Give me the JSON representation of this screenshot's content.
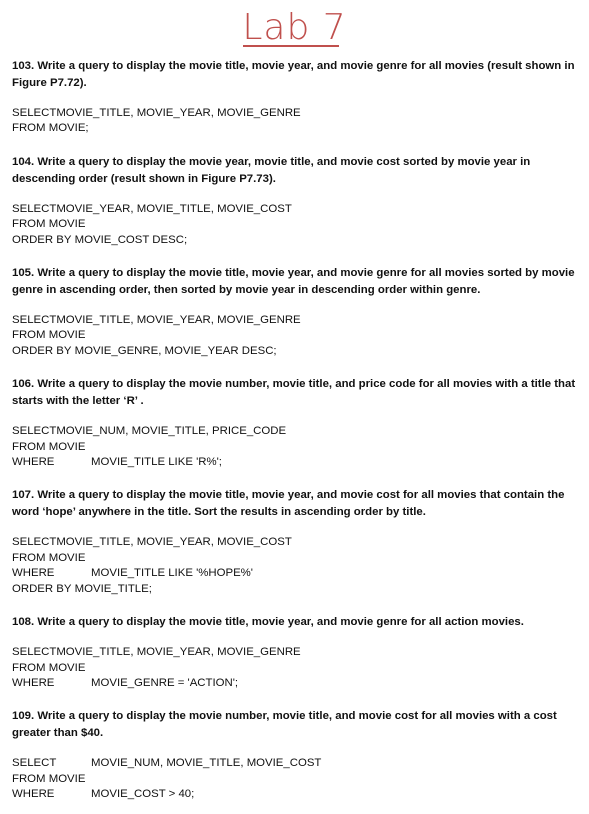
{
  "title": "Lab 7",
  "questions": [
    {
      "text": "103. Write a query to display the movie title, movie year, and movie genre for all movies (result shown in Figure P7.72).",
      "sql": [
        {
          "kw": "SELECT",
          "rest": "MOVIE_TITLE, MOVIE_YEAR, MOVIE_GENRE",
          "wide": false
        },
        {
          "kw": "FROM",
          "rest": " MOVIE;",
          "wide": false
        }
      ]
    },
    {
      "text": "104. Write a query to display the movie year, movie title, and movie cost sorted by movie year in descending order (result shown in Figure P7.73).",
      "sql": [
        {
          "kw": "SELECT",
          "rest": "MOVIE_YEAR, MOVIE_TITLE, MOVIE_COST",
          "wide": false
        },
        {
          "kw": "FROM",
          "rest": " MOVIE",
          "wide": false
        },
        {
          "kw": "ORDER BY",
          "rest": " MOVIE_COST DESC;",
          "wide": false
        }
      ]
    },
    {
      "text": "105. Write a query to display the movie title, movie year, and movie genre for all movies sorted by movie genre in ascending order, then sorted by movie year in descending order within genre.",
      "sql": [
        {
          "kw": "SELECT",
          "rest": "MOVIE_TITLE, MOVIE_YEAR, MOVIE_GENRE",
          "wide": false
        },
        {
          "kw": "FROM",
          "rest": " MOVIE",
          "wide": false
        },
        {
          "kw": "ORDER BY",
          "rest": " MOVIE_GENRE, MOVIE_YEAR DESC;",
          "wide": false
        }
      ]
    },
    {
      "text": "106. Write a query to display the movie number, movie title, and price code for all movies with a title that starts with the letter ‘R’ .",
      "sql": [
        {
          "kw": "SELECT",
          "rest": "MOVIE_NUM, MOVIE_TITLE, PRICE_CODE",
          "wide": false
        },
        {
          "kw": "FROM",
          "rest": " MOVIE",
          "wide": false
        },
        {
          "kw": "WHERE",
          "rest": "MOVIE_TITLE LIKE 'R%';",
          "wide": true
        }
      ]
    },
    {
      "text": "107. Write a query to display the movie title, movie year, and movie cost for all movies that contain the word ‘hope’ anywhere in the title.  Sort the results in ascending order by title.",
      "sql": [
        {
          "kw": "SELECT",
          "rest": "MOVIE_TITLE, MOVIE_YEAR, MOVIE_COST",
          "wide": false
        },
        {
          "kw": "FROM",
          "rest": " MOVIE",
          "wide": false
        },
        {
          "kw": "WHERE",
          "rest": "MOVIE_TITLE LIKE '%HOPE%'",
          "wide": true
        },
        {
          "kw": "ORDER BY",
          "rest": " MOVIE_TITLE;",
          "wide": false
        }
      ]
    },
    {
      "text": "108. Write a query to display the movie title, movie year, and movie genre for all action movies.",
      "sql": [
        {
          "kw": "SELECT",
          "rest": "MOVIE_TITLE, MOVIE_YEAR, MOVIE_GENRE",
          "wide": false
        },
        {
          "kw": "FROM",
          "rest": " MOVIE",
          "wide": false
        },
        {
          "kw": "WHERE",
          "rest": "MOVIE_GENRE = 'ACTION';",
          "wide": true
        }
      ]
    },
    {
      "text": "109.    Write a query to display the movie number, movie title, and movie cost for all movies with a cost greater than $40.",
      "sql": [
        {
          "kw": "SELECT",
          "rest": "MOVIE_NUM, MOVIE_TITLE, MOVIE_COST",
          "wide": true
        },
        {
          "kw": "FROM",
          "rest": " MOVIE",
          "wide": false
        },
        {
          "kw": "WHERE",
          "rest": "MOVIE_COST > 40;",
          "wide": true
        }
      ]
    }
  ],
  "colors": {
    "title": "#c0504d",
    "text": "#111111"
  }
}
